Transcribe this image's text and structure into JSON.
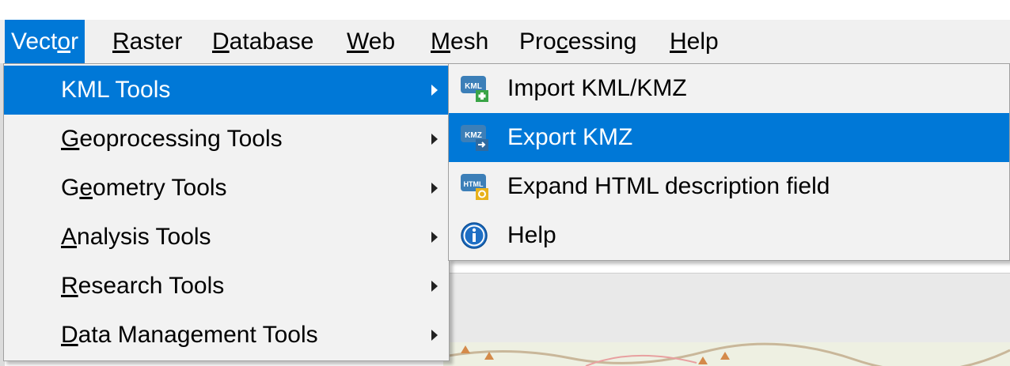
{
  "menubar": {
    "items": [
      {
        "pre": "Vect",
        "u": "o",
        "post": "r",
        "active": true
      },
      {
        "pre": "",
        "u": "R",
        "post": "aster",
        "active": false
      },
      {
        "pre": "",
        "u": "D",
        "post": "atabase",
        "active": false
      },
      {
        "pre": "",
        "u": "W",
        "post": "eb",
        "active": false
      },
      {
        "pre": "",
        "u": "M",
        "post": "esh",
        "active": false
      },
      {
        "pre": "Pro",
        "u": "c",
        "post": "essing",
        "active": false
      },
      {
        "pre": "",
        "u": "H",
        "post": "elp",
        "active": false
      }
    ]
  },
  "vector_menu": {
    "items": [
      {
        "pre": "KML Tools",
        "u": "",
        "post": "",
        "highlighted": true
      },
      {
        "pre": "",
        "u": "G",
        "post": "eoprocessing Tools",
        "highlighted": false
      },
      {
        "pre": "G",
        "u": "e",
        "post": "ometry Tools",
        "highlighted": false
      },
      {
        "pre": "",
        "u": "A",
        "post": "nalysis Tools",
        "highlighted": false
      },
      {
        "pre": "",
        "u": "R",
        "post": "esearch Tools",
        "highlighted": false
      },
      {
        "pre": "",
        "u": "D",
        "post": "ata Management Tools",
        "highlighted": false
      }
    ]
  },
  "kml_submenu": {
    "items": [
      {
        "label": "Import KML/KMZ",
        "icon": "import-kml-icon",
        "badge": "KML",
        "highlighted": false
      },
      {
        "label": "Export KMZ",
        "icon": "export-kmz-icon",
        "badge": "KMZ",
        "highlighted": true
      },
      {
        "label": "Expand HTML description field",
        "icon": "expand-html-icon",
        "badge": "HTML",
        "highlighted": false
      },
      {
        "label": "Help",
        "icon": "info-icon",
        "badge": "",
        "highlighted": false
      }
    ]
  },
  "colors": {
    "highlight": "#0078d7",
    "menu_bg": "#f2f2f2",
    "menubar_bg": "#f0f0f0"
  }
}
